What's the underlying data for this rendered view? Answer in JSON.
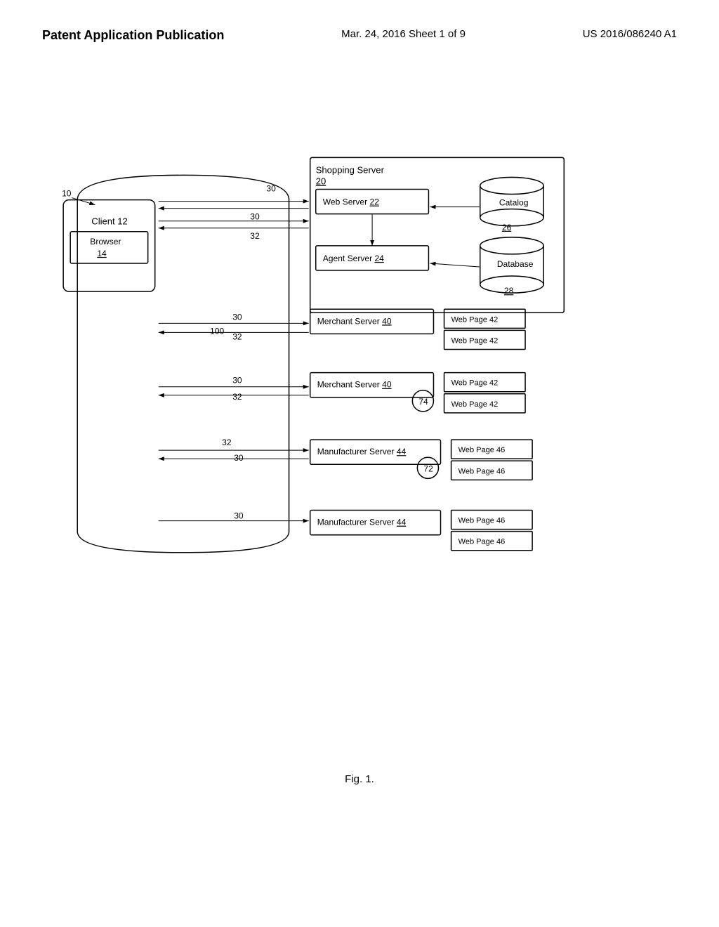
{
  "header": {
    "left": "Patent Application Publication",
    "center": "Mar. 24, 2016  Sheet 1 of 9",
    "right": "US 2016/086240 A1"
  },
  "fig_caption": "Fig. 1.",
  "diagram": {
    "labels": {
      "ref_10": "10",
      "ref_20": "20",
      "ref_22": "22",
      "ref_24": "24",
      "ref_26": "26",
      "ref_28": "28",
      "ref_30_1": "30",
      "ref_30_2": "30",
      "ref_30_3": "30",
      "ref_30_4": "30",
      "ref_30_5": "30",
      "ref_30_6": "30",
      "ref_32_1": "32",
      "ref_32_2": "32",
      "ref_32_3": "32",
      "ref_32_4": "32",
      "ref_100": "100",
      "ref_72": "72",
      "ref_74": "74",
      "client_label": "Client 12",
      "browser_label": "Browser",
      "browser_ref": "14",
      "shopping_server": "Shopping Server",
      "web_server": "Web Server",
      "agent_server": "Agent Server",
      "catalog": "Catalog",
      "database": "Database",
      "merchant_server_40_1": "Merchant Server",
      "merchant_server_40_2": "Merchant Server",
      "manufacturer_server_44_1": "Manufacturer Server",
      "manufacturer_server_44_2": "Manufacturer Server",
      "web_page_42_1": "Web Page 42",
      "web_page_42_2": "Web Page 42",
      "web_page_42_3": "Web Page 42",
      "web_page_42_4": "Web Page 42",
      "web_page_46_1": "Web Page 46",
      "web_page_46_2": "Web Page 46",
      "web_page_46_3": "Web Page 46",
      "web_page_46_4": "Web Page 46"
    }
  }
}
